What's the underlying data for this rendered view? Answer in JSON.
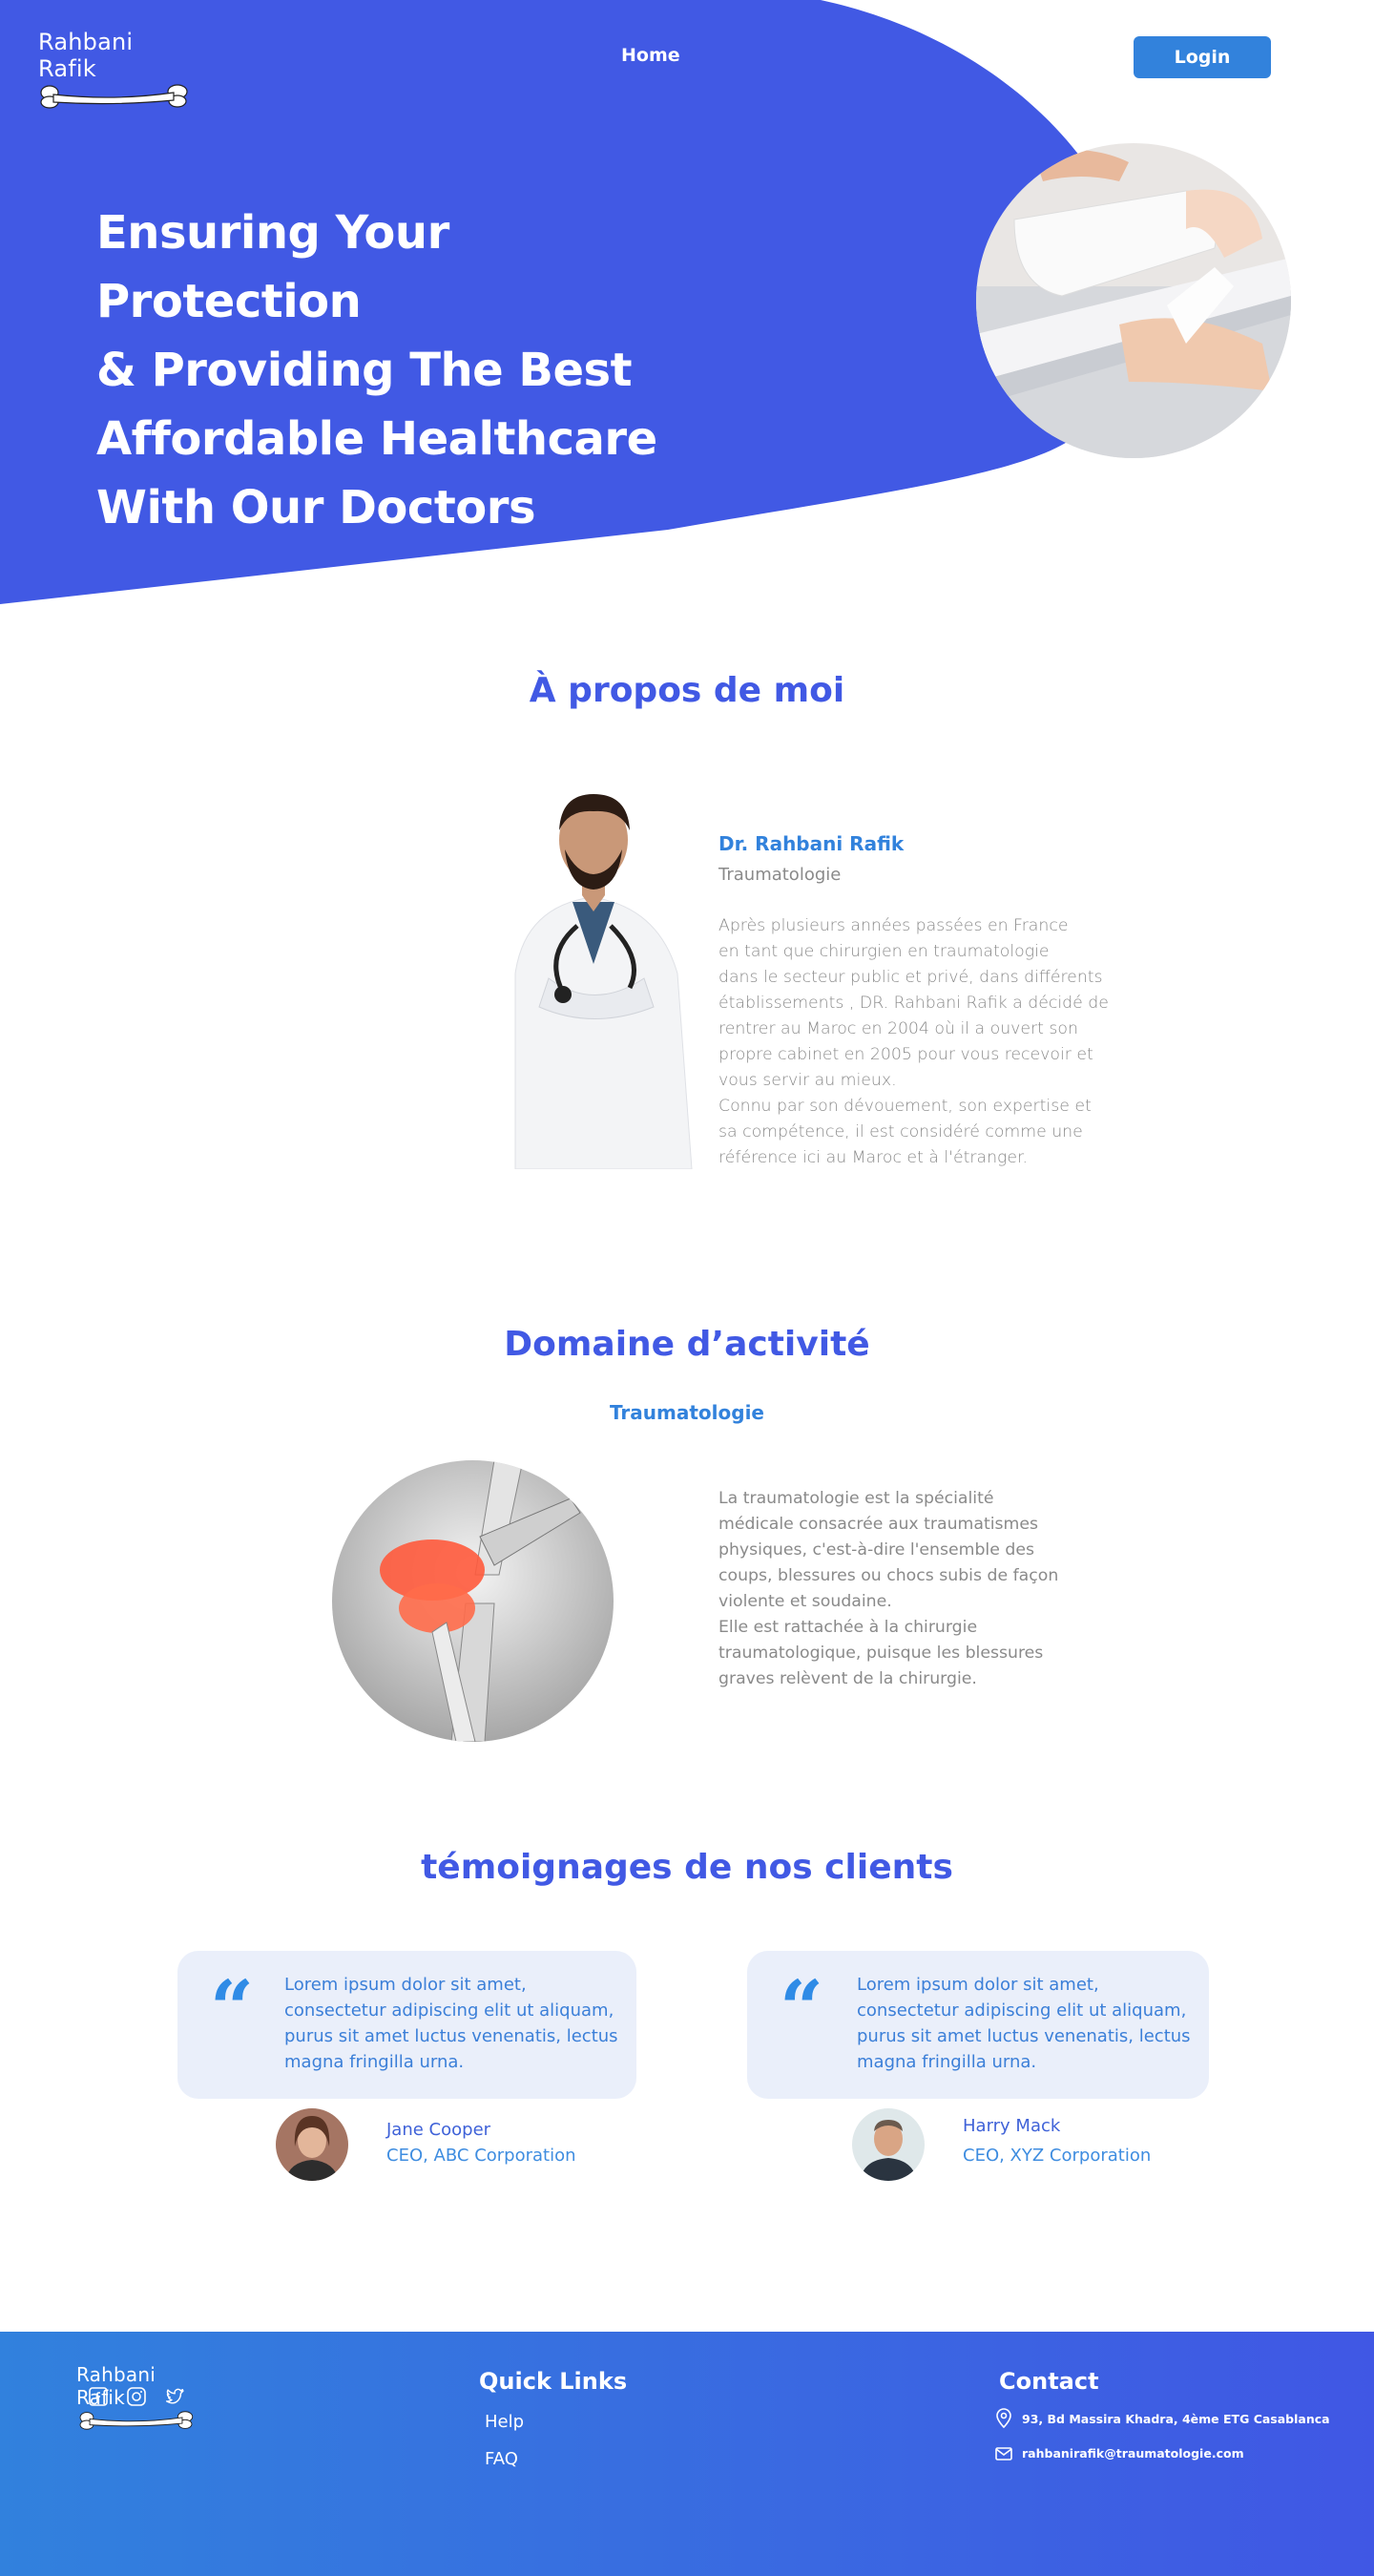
{
  "header": {
    "logo_text": "Rahbani Rafik",
    "nav_home": "Home",
    "login_label": "Login"
  },
  "hero": {
    "title_lines": [
      "Ensuring Your Protection",
      "& Providing The Best",
      "Affordable Healthcare",
      "With Our Doctors"
    ]
  },
  "about": {
    "title": "À propos de moi",
    "name": "Dr. Rahbani Rafik",
    "specialty": "Traumatologie",
    "bio": "Après  plusieurs  années passées en France\nen  tant  que  chirurgien en  traumatologie\ndans le secteur public et privé,  dans différents\nétablissements , DR. Rahbani Rafik a décidé de\nrentrer au Maroc en 2004 où il a ouvert son\npropre cabinet en 2005 pour vous recevoir et\nvous servir au mieux.\nConnu par son dévouement, son expertise et\nsa compétence, il est considéré comme une\nréférence ici au Maroc  et à l'étranger."
  },
  "domain": {
    "title": "Domaine d’activité",
    "subtitle": "Traumatologie",
    "text": " La traumatologie est la spécialité\nmédicale consacrée aux traumatismes\nphysiques, c'est-à-dire l'ensemble des\ncoups, blessures ou chocs subis de façon\nviolente et soudaine.\n Elle  est rattachée à la chirurgie\ntraumatologique, puisque les blessures\ngraves relèvent de la chirurgie."
  },
  "testimonials": {
    "title": "témoignages de nos clients",
    "items": [
      {
        "text": "Lorem ipsum dolor sit amet, consectetur adipiscing elit ut aliquam, purus sit amet luctus venenatis, lectus magna fringilla urna.",
        "name": "Jane Cooper",
        "role": "CEO, ABC Corporation"
      },
      {
        "text": "Lorem ipsum dolor sit amet, consectetur adipiscing elit ut aliquam, purus sit amet luctus venenatis, lectus magna fringilla urna.",
        "name": "Harry Mack",
        "role": "CEO, XYZ Corporation"
      }
    ]
  },
  "footer": {
    "logo_text": "Rahbani Rafik",
    "quick_links_title": "Quick Links",
    "links": [
      "Help",
      "FAQ"
    ],
    "contact_title": "Contact",
    "address": "93, Bd Massira Khadra, 4ème ETG Casablanca",
    "email": "rahbanirafik@traumatologie.com",
    "social_icons": [
      "facebook-icon",
      "instagram-icon",
      "twitter-icon"
    ]
  },
  "colors": {
    "primary": "#4159e4",
    "accent": "#3282dc",
    "card_bg": "#eaeffa",
    "text_gray": "#8a8a8a"
  }
}
